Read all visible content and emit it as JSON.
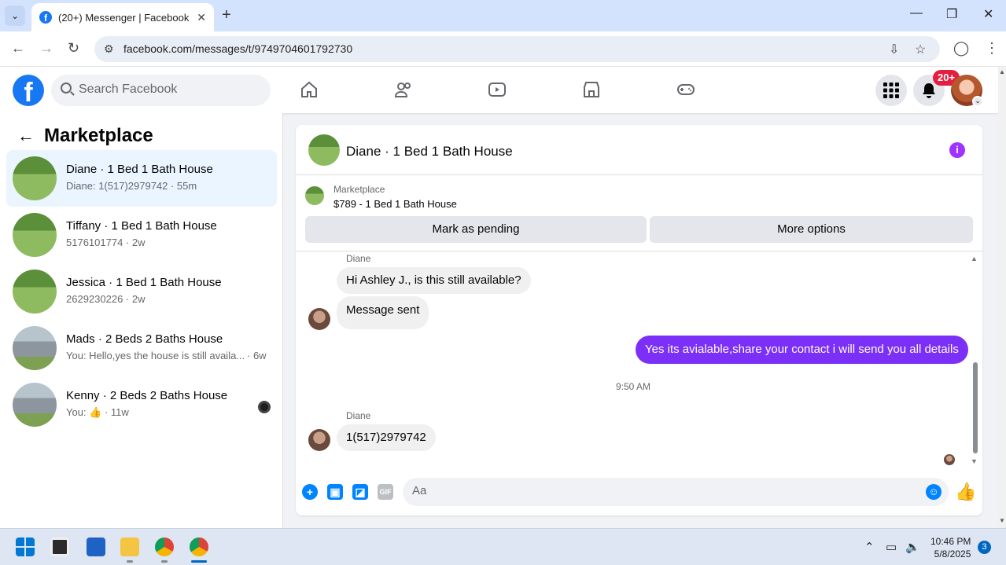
{
  "browser": {
    "tab_title": "(20+) Messenger | Facebook",
    "url": "facebook.com/messages/t/9749704601792730"
  },
  "fb": {
    "logo": "f",
    "search_placeholder": "Search Facebook",
    "notification_badge": "20+",
    "nav_icons": [
      "home-icon",
      "friends-icon",
      "video-icon",
      "marketplace-icon",
      "gaming-icon"
    ]
  },
  "left": {
    "title": "Marketplace",
    "conversations": [
      {
        "name": "Diane · 1 Bed 1 Bath House",
        "preview": "Diane: 1(517)2979742 · 55m",
        "active": true
      },
      {
        "name": "Tiffany · 1 Bed 1 Bath House",
        "preview": "5176101774 · 2w"
      },
      {
        "name": "Jessica · 1 Bed 1 Bath House",
        "preview": "2629230226 · 2w"
      },
      {
        "name": "Mads · 2 Beds 2 Baths House",
        "preview": "You: Hello,yes the house is still availa...",
        "time": "· 6w"
      },
      {
        "name": "Kenny · 2 Beds 2 Baths House",
        "preview": "You: 👍 · 11w"
      }
    ]
  },
  "chat": {
    "title": "Diane · 1 Bed 1 Bath House",
    "marketplace_label": "Marketplace",
    "listing": "$789 - 1 Bed 1 Bath House",
    "mark_pending": "Mark as pending",
    "more_options": "More options",
    "messages": [
      {
        "sender": "Diane",
        "text": "Hi Ashley J., is this still available?"
      },
      {
        "text": "Message sent"
      },
      {
        "text": "Yes its avialable,share your contact i will send you all details",
        "outgoing": true
      },
      {
        "sender": "Diane",
        "text": "1(517)2979742"
      }
    ],
    "timestamp": "9:50 AM",
    "composer_placeholder": "Aa"
  },
  "taskbar": {
    "time": "10:46 PM",
    "date": "5/8/2025",
    "notifications": "3"
  },
  "colors": {
    "fb_blue": "#1877f2",
    "outgoing_bubble": "#7b2ff7",
    "active_row": "#ebf5ff",
    "badge_red": "#e41e3f"
  }
}
